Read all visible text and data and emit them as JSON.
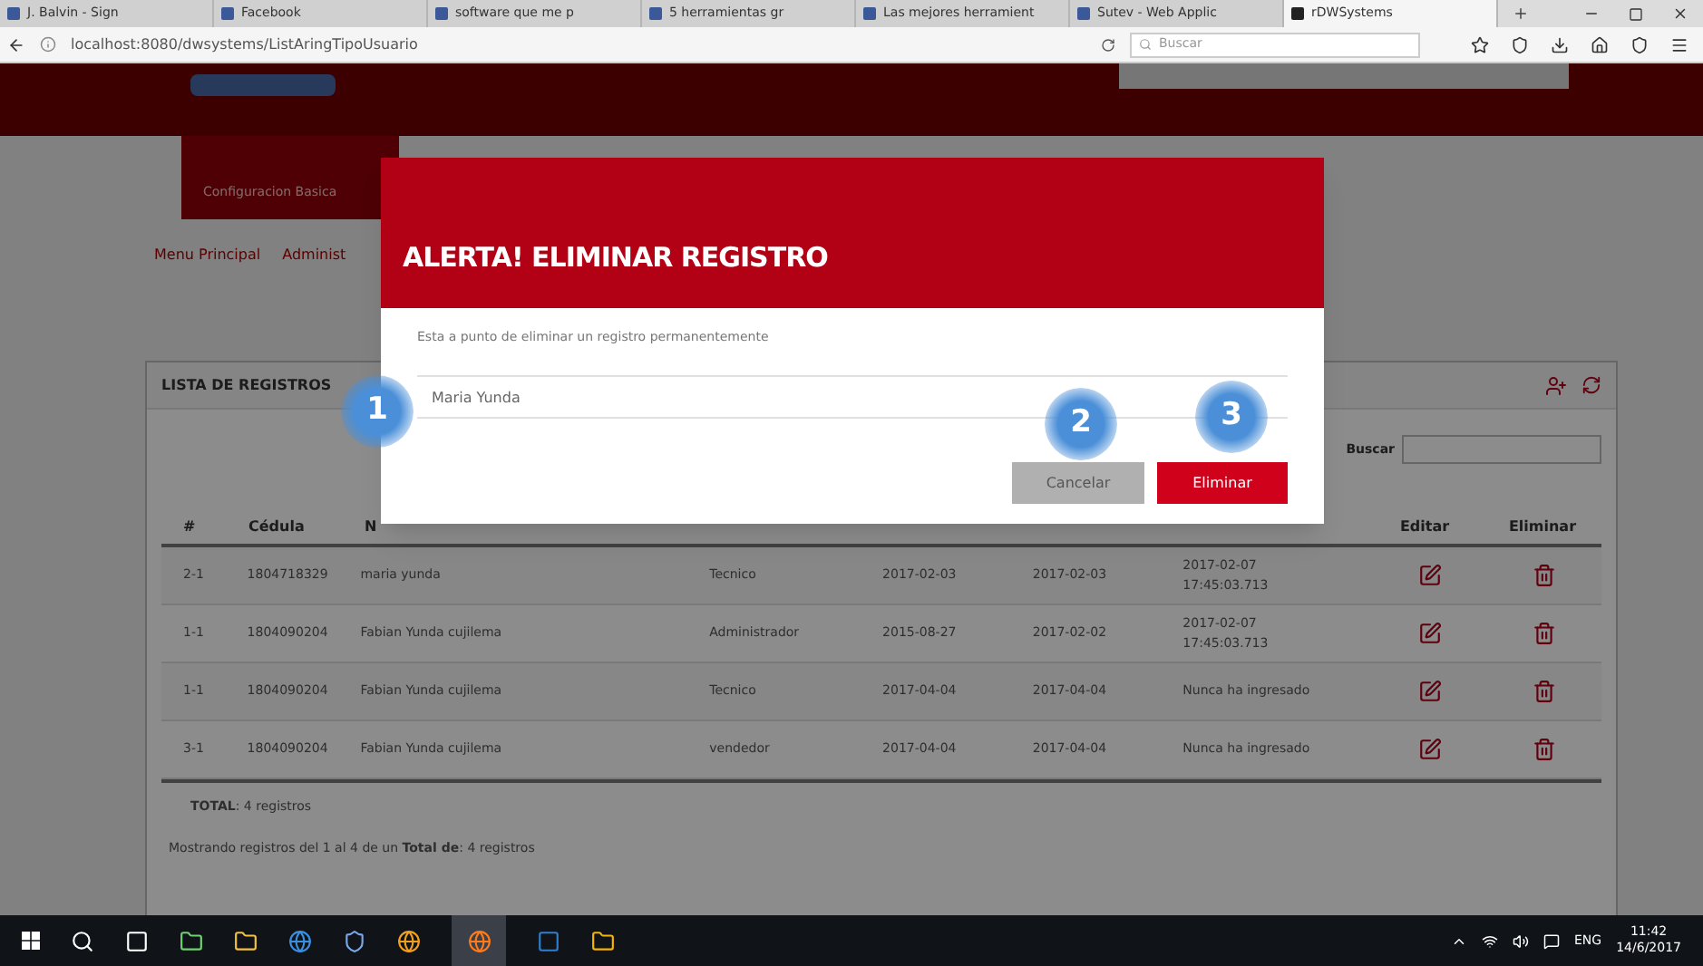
{
  "browser": {
    "tabs": [
      {
        "label": "J. Balvin - Sign",
        "selected": false
      },
      {
        "label": "Facebook",
        "selected": false
      },
      {
        "label": "software que me p",
        "selected": false
      },
      {
        "label": "5 herramientas gr",
        "selected": false
      },
      {
        "label": "Las mejores herramient",
        "selected": false
      },
      {
        "label": "Sutev - Web Applic",
        "selected": false
      },
      {
        "label": "rDWSystems",
        "selected": true
      }
    ],
    "url": "localhost:8080/dwsystems/ListAringTipoUsuario",
    "search_placeholder": "Buscar"
  },
  "nav": {
    "menu": "Configuracion Basica",
    "breadcrumb": [
      "Menu Principal",
      "Administ"
    ]
  },
  "card": {
    "title": "LISTA DE REGISTROS",
    "search_label": "Buscar",
    "columns": [
      "#",
      "Cédula",
      "N",
      "Editar",
      "Eliminar"
    ],
    "rows": [
      {
        "cells": [
          "2-1",
          "1804718329",
          "maria yunda",
          "Tecnico",
          "2017-02-03",
          "2017-02-03",
          "2017-02-07 17:45:03.713"
        ]
      },
      {
        "cells": [
          "1-1",
          "1804090204",
          "Fabian Yunda cujilema",
          "Administrador",
          "2015-08-27",
          "2017-02-02",
          "2017-02-07 17:45:03.713"
        ]
      },
      {
        "cells": [
          "1-1",
          "1804090204",
          "Fabian Yunda cujilema",
          "Tecnico",
          "2017-04-04",
          "2017-04-04",
          "Nunca ha ingresado"
        ]
      },
      {
        "cells": [
          "3-1",
          "1804090204",
          "Fabian Yunda cujilema",
          "vendedor",
          "2017-04-04",
          "2017-04-04",
          "Nunca ha ingresado"
        ]
      }
    ],
    "total": "**TOTAL**: 4 registros",
    "summary": "Mostrando registros del 1 al 4 de un **Total de**: 4 registros"
  },
  "modal": {
    "title": "ALERTA! ELIMINAR REGISTRO",
    "message": "Esta a punto de eliminar un registro permanentemente",
    "value": "Maria Yunda",
    "buttons": [
      {
        "label": "Cancelar",
        "kind": "secondary"
      },
      {
        "label": "Eliminar",
        "kind": "danger"
      }
    ]
  },
  "callouts": [
    "1",
    "2",
    "3"
  ],
  "taskbar": {
    "language": "ENG",
    "time": "11:42",
    "date": "14/6/2017"
  }
}
